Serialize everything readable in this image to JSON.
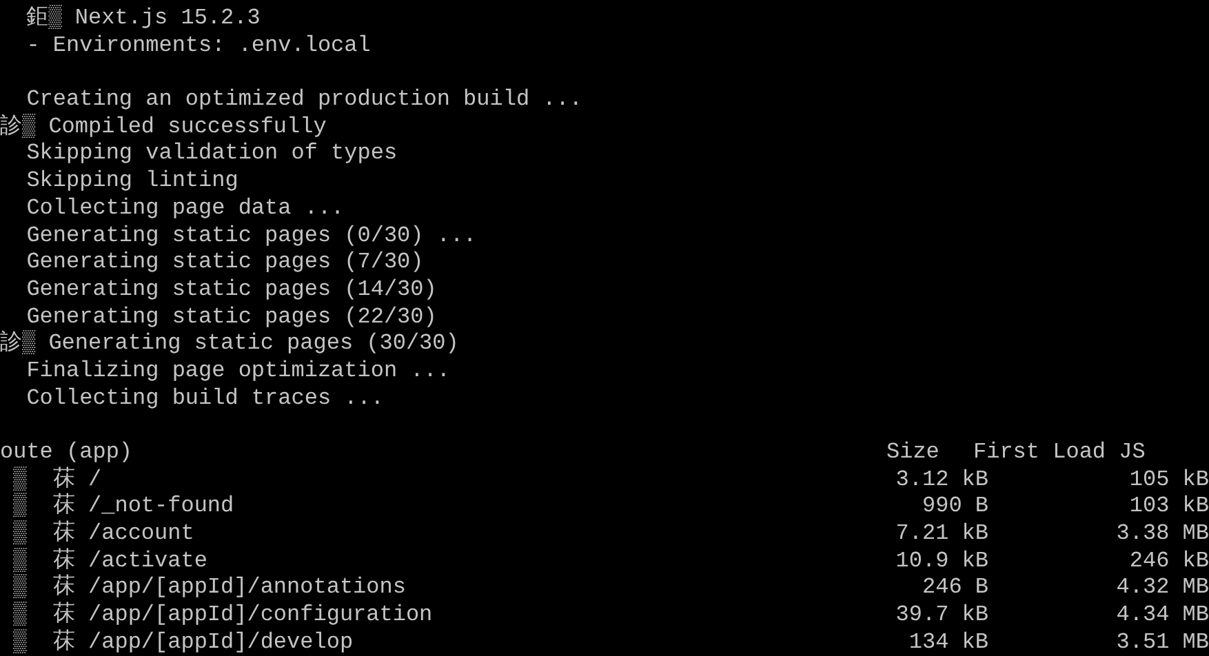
{
  "log_lines": [
    {
      "text": "  鉅▒ Next.js 15.2.3"
    },
    {
      "text": "  - Environments: .env.local"
    },
    {
      "text": "  Creating an optimized production build ...",
      "gap_before": true
    },
    {
      "text": "診▒ Compiled successfully"
    },
    {
      "text": "  Skipping validation of types"
    },
    {
      "text": "  Skipping linting"
    },
    {
      "text": "  Collecting page data ..."
    },
    {
      "text": "  Generating static pages (0/30) ..."
    },
    {
      "text": "  Generating static pages (7/30)"
    },
    {
      "text": "  Generating static pages (14/30)"
    },
    {
      "text": "  Generating static pages (22/30)"
    },
    {
      "text": "診▒ Generating static pages (30/30)"
    },
    {
      "text": "  Finalizing page optimization ..."
    },
    {
      "text": "  Collecting build traces ..."
    }
  ],
  "route_table": {
    "gap_before": true,
    "columns": [
      "oute (app)",
      "Size",
      "First Load JS"
    ],
    "rows": [
      {
        "route": " ▒  茠 /",
        "size": "3.12 kB",
        "first_load": "105 kB"
      },
      {
        "route": " ▒  茠 /_not-found",
        "size": "990 B",
        "first_load": "103 kB"
      },
      {
        "route": " ▒  茠 /account",
        "size": "7.21 kB",
        "first_load": "3.38 MB"
      },
      {
        "route": " ▒  茠 /activate",
        "size": "10.9 kB",
        "first_load": "246 kB"
      },
      {
        "route": " ▒  茠 /app/[appId]/annotations",
        "size": "246 B",
        "first_load": "4.32 MB"
      },
      {
        "route": " ▒  茠 /app/[appId]/configuration",
        "size": "39.7 kB",
        "first_load": "4.34 MB"
      },
      {
        "route": " ▒  茠 /app/[appId]/develop",
        "size": "134 kB",
        "first_load": "3.51 MB"
      }
    ]
  }
}
